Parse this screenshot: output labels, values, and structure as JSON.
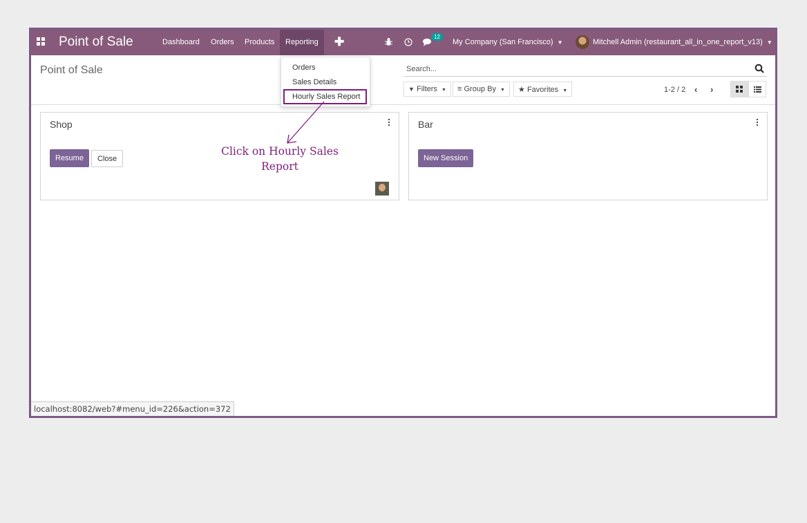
{
  "navbar": {
    "app_title": "Point of Sale",
    "menus": [
      "Dashboard",
      "Orders",
      "Products",
      "Reporting"
    ],
    "plus": "✚",
    "messages_count": "12",
    "company": "My Company (San Francisco)",
    "user": "Mitchell Admin (restaurant_all_in_one_report_v13)",
    "color": "#875a7b"
  },
  "reporting_menu": [
    "Orders",
    "Sales Details",
    "Hourly Sales Report"
  ],
  "control_panel": {
    "title": "Point of Sale",
    "search_placeholder": "Search...",
    "filters": "Filters",
    "group_by": "Group By",
    "favorites": "Favorites",
    "pager": "1-2 / 2"
  },
  "cards": [
    {
      "title": "Shop",
      "primary": "Resume",
      "secondary": "Close"
    },
    {
      "title": "Bar",
      "primary": "New Session"
    }
  ],
  "annotation": "Click on Hourly Sales Report",
  "status_url": "localhost:8082/web?#menu_id=226&action=372"
}
